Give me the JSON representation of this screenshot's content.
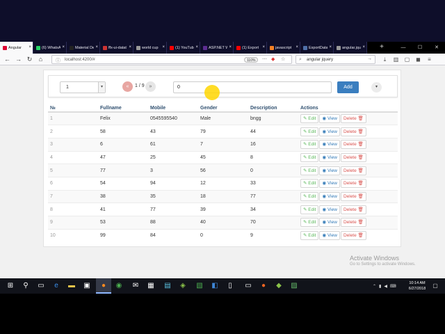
{
  "browser": {
    "tabs": [
      {
        "title": "Angular",
        "favicon_color": "#dd0031",
        "active": true
      },
      {
        "title": "(6) WhatsApp",
        "favicon_color": "#25d366",
        "active": false
      },
      {
        "title": "Material De",
        "favicon_color": "#222222",
        "active": false
      },
      {
        "title": "ffx-ui-datat",
        "favicon_color": "#cc3333",
        "active": false
      },
      {
        "title": "world cup",
        "favicon_color": "#999999",
        "active": false
      },
      {
        "title": "(1) YouTub",
        "favicon_color": "#ff0000",
        "active": false
      },
      {
        "title": "ASP.NET W",
        "favicon_color": "#5c2d91",
        "active": false
      },
      {
        "title": "(1) Export",
        "favicon_color": "#ff0000",
        "active": false
      },
      {
        "title": "javascript",
        "favicon_color": "#f48024",
        "active": false
      },
      {
        "title": "ExportData",
        "favicon_color": "#4f6fa8",
        "active": false
      },
      {
        "title": "angular.jqu",
        "favicon_color": "#999999",
        "active": false
      }
    ],
    "url": "localhost:4200/#",
    "zoom": "110%",
    "search_text": "angular jquery"
  },
  "controls": {
    "page_select_value": "1",
    "prev_label": "«",
    "pager_label": "1 / 9",
    "next_label": "»",
    "filter_value": "0",
    "add_label": "Add",
    "options_label": "▾"
  },
  "table": {
    "headers": [
      "№",
      "Fullname",
      "Mobile",
      "Gender",
      "Description",
      "Actions"
    ],
    "edit_label": "Edit",
    "view_label": "View",
    "delete_label": "Delete",
    "rows": [
      [
        "1",
        "Felix",
        "0545595540",
        "Male",
        "bngg"
      ],
      [
        "2",
        "58",
        "43",
        "79",
        "44"
      ],
      [
        "3",
        "6",
        "61",
        "7",
        "16"
      ],
      [
        "4",
        "47",
        "25",
        "45",
        "8"
      ],
      [
        "5",
        "77",
        "3",
        "56",
        "0"
      ],
      [
        "6",
        "54",
        "94",
        "12",
        "33"
      ],
      [
        "7",
        "38",
        "35",
        "18",
        "77"
      ],
      [
        "8",
        "41",
        "77",
        "39",
        "34"
      ],
      [
        "9",
        "53",
        "88",
        "40",
        "70"
      ],
      [
        "10",
        "99",
        "84",
        "0",
        "9"
      ]
    ]
  },
  "watermark": {
    "title": "Activate Windows",
    "subtitle": "Go to Settings to activate Windows."
  },
  "taskbar": {
    "time": "10:14 AM",
    "date": "6/27/2018"
  }
}
